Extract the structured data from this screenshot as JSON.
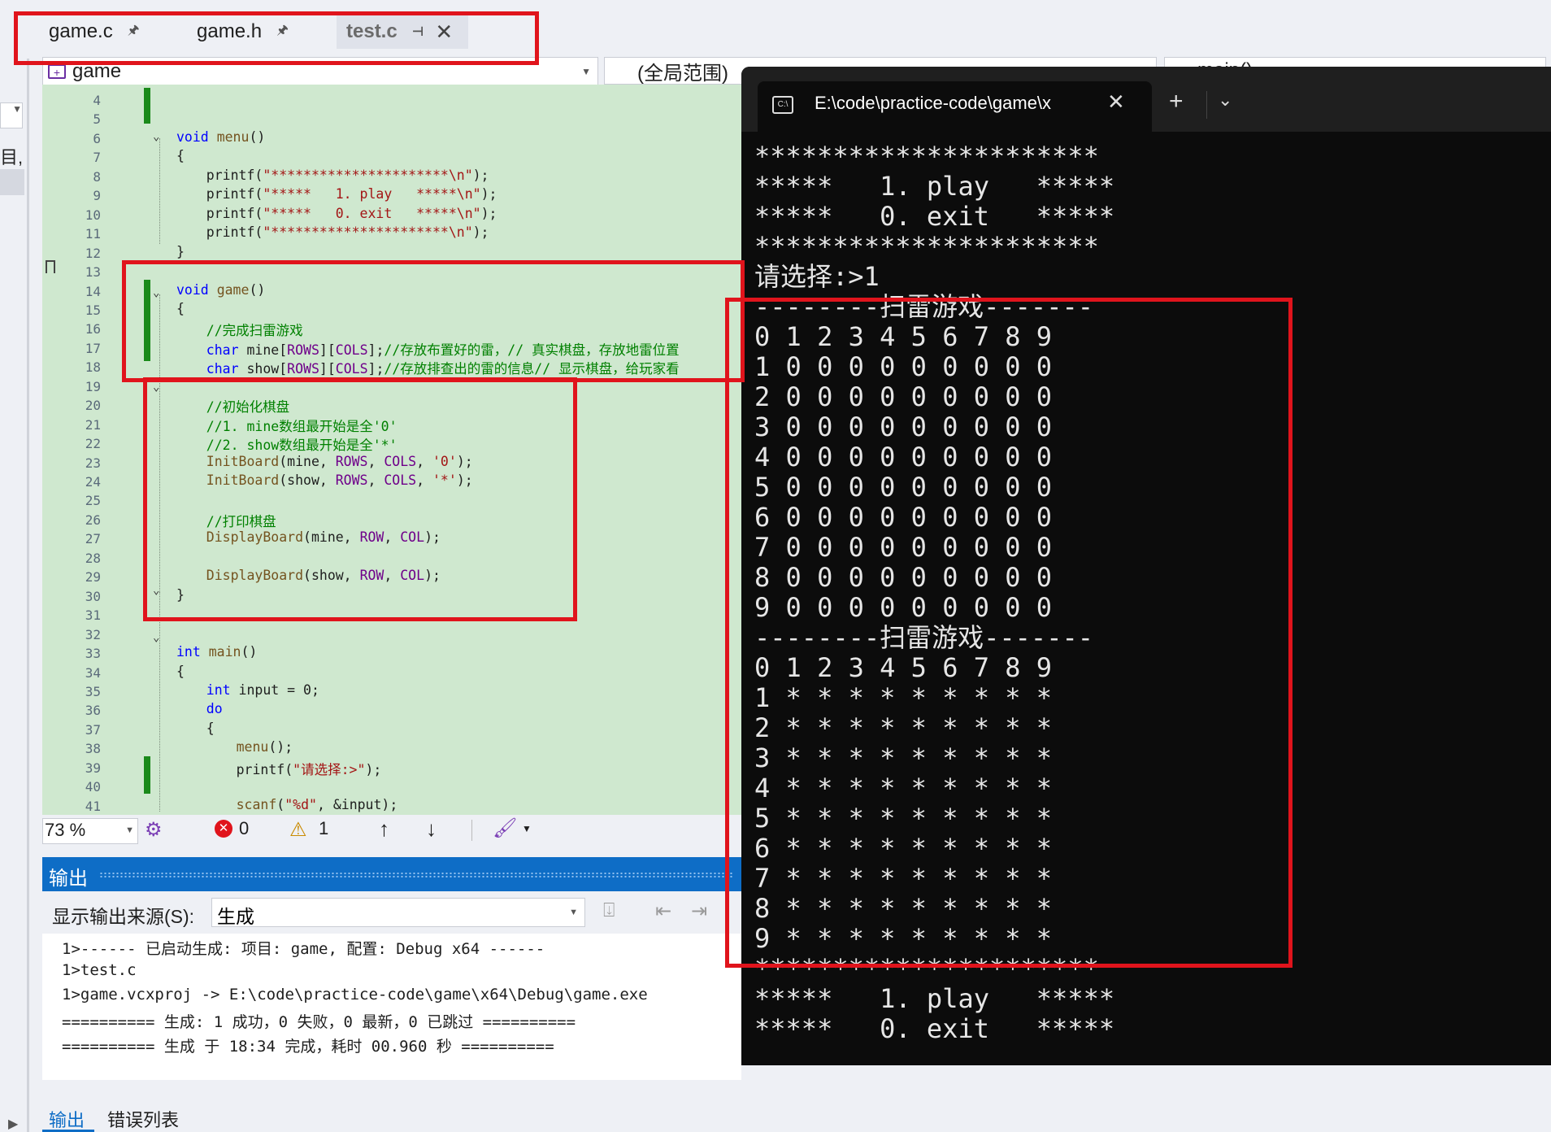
{
  "tabs": [
    {
      "name": "game.c",
      "pin": "🖈"
    },
    {
      "name": "game.h",
      "pin": "🖈"
    },
    {
      "name": "test.c",
      "pin": "⊣",
      "close": "✕"
    }
  ],
  "nav": {
    "project": "game",
    "scope": "(全局范围)",
    "member": "main()"
  },
  "sidebar": {
    "text": "目,"
  },
  "editor": {
    "lines": [
      {
        "n": "4",
        "html": ""
      },
      {
        "n": "5",
        "html": ""
      },
      {
        "n": "6",
        "html": "<span class=\"kw\">void</span> <span class=\"fn\">menu</span>()"
      },
      {
        "n": "7",
        "html": "{"
      },
      {
        "n": "8",
        "html": "    printf(<span class=\"str\">\"**********************\\n\"</span>);"
      },
      {
        "n": "9",
        "html": "    printf(<span class=\"str\">\"*****   1. play   *****\\n\"</span>);"
      },
      {
        "n": "10",
        "html": "    printf(<span class=\"str\">\"*****   0. exit   *****\\n\"</span>);"
      },
      {
        "n": "11",
        "html": "    printf(<span class=\"str\">\"**********************\\n\"</span>);"
      },
      {
        "n": "12",
        "html": "}"
      },
      {
        "n": "13",
        "html": ""
      },
      {
        "n": "14",
        "html": "<span class=\"kw\">void</span> <span class=\"fn\">game</span>()"
      },
      {
        "n": "15",
        "html": "{"
      },
      {
        "n": "16",
        "html": "    <span class=\"cm\">//完成扫雷游戏</span>"
      },
      {
        "n": "17",
        "html": "    <span class=\"kw\">char</span> mine[<span class=\"mac\">ROWS</span>][<span class=\"mac\">COLS</span>];<span class=\"cm\">//存放布置好的雷，// 真实棋盘，存放地雷位置</span>"
      },
      {
        "n": "18",
        "html": "    <span class=\"kw\">char</span> show[<span class=\"mac\">ROWS</span>][<span class=\"mac\">COLS</span>];<span class=\"cm\">//存放排查出的雷的信息// 显示棋盘，给玩家看</span>"
      },
      {
        "n": "19",
        "html": ""
      },
      {
        "n": "20",
        "html": "    <span class=\"cm\">//初始化棋盘</span>"
      },
      {
        "n": "21",
        "html": "    <span class=\"cm\">//1. mine数组最开始是全'0'</span>"
      },
      {
        "n": "22",
        "html": "    <span class=\"cm\">//2. show数组最开始是全'*'</span>"
      },
      {
        "n": "23",
        "html": "    <span class=\"fn\">InitBoard</span>(mine, <span class=\"mac\">ROWS</span>, <span class=\"mac\">COLS</span>, <span class=\"str\">'0'</span>);"
      },
      {
        "n": "24",
        "html": "    <span class=\"fn\">InitBoard</span>(show, <span class=\"mac\">ROWS</span>, <span class=\"mac\">COLS</span>, <span class=\"str\">'*'</span>);"
      },
      {
        "n": "25",
        "html": ""
      },
      {
        "n": "26",
        "html": "    <span class=\"cm\">//打印棋盘</span>"
      },
      {
        "n": "27",
        "html": "    <span class=\"fn\">DisplayBoard</span>(mine, <span class=\"mac\">ROW</span>, <span class=\"mac\">COL</span>);"
      },
      {
        "n": "28",
        "html": ""
      },
      {
        "n": "29",
        "html": "    <span class=\"fn\">DisplayBoard</span>(show, <span class=\"mac\">ROW</span>, <span class=\"mac\">COL</span>);"
      },
      {
        "n": "30",
        "html": "}"
      },
      {
        "n": "31",
        "html": ""
      },
      {
        "n": "32",
        "html": ""
      },
      {
        "n": "33",
        "html": "<span class=\"kw\">int</span> <span class=\"fn\">main</span>()"
      },
      {
        "n": "34",
        "html": "{"
      },
      {
        "n": "35",
        "html": "    <span class=\"kw\">int</span> input = 0;"
      },
      {
        "n": "36",
        "html": "    <span class=\"kw\">do</span>"
      },
      {
        "n": "37",
        "html": "    {"
      },
      {
        "n": "38",
        "html": "        <span class=\"fn\">menu</span>();"
      },
      {
        "n": "39",
        "html": "        printf(<span class=\"str\">\"请选择:>\"</span>);"
      },
      {
        "n": "40",
        "html": ""
      },
      {
        "n": "41",
        "html": "        <span class=\"fn\">scanf</span>(<span class=\"str\">\"%d\"</span>, &amp;input);"
      }
    ]
  },
  "editor_status": {
    "zoom": "73 %",
    "errors": "0",
    "warnings": "1"
  },
  "output": {
    "title": "输出",
    "source_label": "显示输出来源(S):",
    "source_value": "生成",
    "lines": [
      "1>------ 已启动生成: 项目: game, 配置: Debug x64 ------",
      "1>test.c",
      "1>game.vcxproj -> E:\\code\\practice-code\\game\\x64\\Debug\\game.exe",
      "========== 生成: 1 成功，0 失败，0 最新，0 已跳过 ==========",
      "========== 生成 于 18:34 完成，耗时 00.960 秒 =========="
    ]
  },
  "bottom_tabs": [
    "输出",
    "错误列表"
  ],
  "terminal": {
    "tab_title": "E:\\code\\practice-code\\game\\x",
    "lines": [
      "**********************",
      "*****   1. play   *****",
      "*****   0. exit   *****",
      "**********************",
      "请选择:>1",
      "--------扫雷游戏-------",
      "0 1 2 3 4 5 6 7 8 9",
      "1 0 0 0 0 0 0 0 0 0",
      "2 0 0 0 0 0 0 0 0 0",
      "3 0 0 0 0 0 0 0 0 0",
      "4 0 0 0 0 0 0 0 0 0",
      "5 0 0 0 0 0 0 0 0 0",
      "6 0 0 0 0 0 0 0 0 0",
      "7 0 0 0 0 0 0 0 0 0",
      "8 0 0 0 0 0 0 0 0 0",
      "9 0 0 0 0 0 0 0 0 0",
      "--------扫雷游戏-------",
      "0 1 2 3 4 5 6 7 8 9",
      "1 * * * * * * * * *",
      "2 * * * * * * * * *",
      "3 * * * * * * * * *",
      "4 * * * * * * * * *",
      "5 * * * * * * * * *",
      "6 * * * * * * * * *",
      "7 * * * * * * * * *",
      "8 * * * * * * * * *",
      "9 * * * * * * * * *",
      "**********************",
      "*****   1. play   *****",
      "*****   0. exit   *****"
    ]
  },
  "colors": {
    "annotation": "#e0141c",
    "editor_bg": "#cfe8cf",
    "terminal_bg": "#0c0c0c",
    "output_header": "#0e6dc6"
  }
}
